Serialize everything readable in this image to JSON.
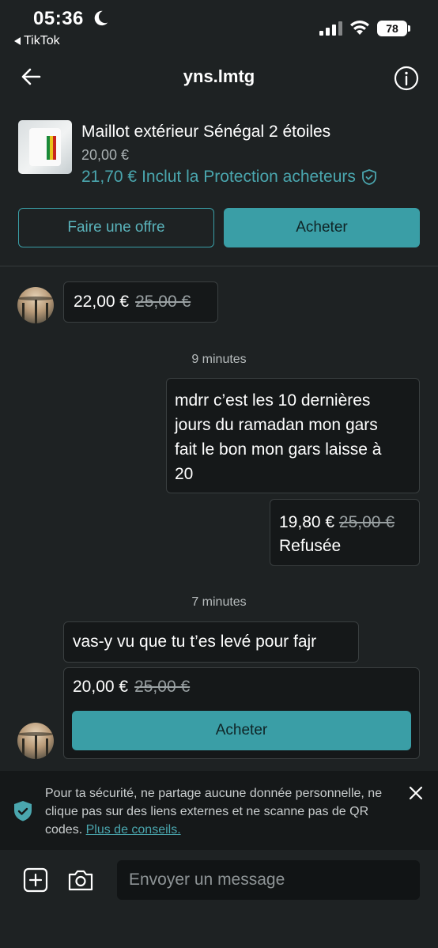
{
  "status_bar": {
    "time": "05:36",
    "back_app": "TikTok",
    "battery": "78"
  },
  "header": {
    "title": "yns.lmtg"
  },
  "product": {
    "title": "Maillot extérieur Sénégal 2 étoiles",
    "price": "20,00 €",
    "total_price": "21,70 €",
    "protection_label": "Inclut la Protection acheteurs",
    "offer_button": "Faire une offre",
    "buy_button": "Acheter"
  },
  "messages": {
    "offer_1": {
      "price": "22,00 €",
      "old_price": "25,00 €"
    },
    "time_1": "9 minutes",
    "msg_me_lines": [
      "mdrr c’est les 10 dernières",
      "jours du ramadan mon gars",
      "fait le bon mon gars laisse à",
      "20"
    ],
    "offer_me": {
      "price": "19,80 €",
      "old_price": "25,00 €",
      "status": "Refusée"
    },
    "time_2": "7 minutes",
    "msg_them": "vas-y vu que tu t’es levé pour fajr",
    "offer_them": {
      "price": "20,00 €",
      "old_price": "25,00 €",
      "buy_button": "Acheter"
    }
  },
  "security_banner": {
    "text": "Pour ta sécurité, ne partage aucune donnée personnelle, ne clique pas sur des liens externes et ne scanne pas de QR codes. ",
    "link": "Plus de conseils."
  },
  "composer": {
    "placeholder": "Envoyer un message"
  },
  "colors": {
    "accent": "#3a9ea6",
    "background": "#1e2223",
    "bubble": "#151819"
  }
}
